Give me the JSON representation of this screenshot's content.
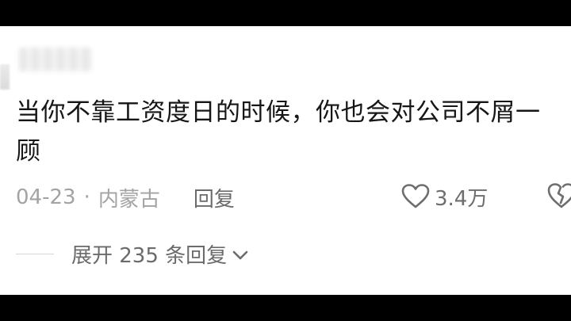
{
  "comment": {
    "text": "当你不靠工资度日的时候，你也会对公司不屑一顾",
    "date": "04-23",
    "separator": "·",
    "location": "内蒙古",
    "reply_label": "回复",
    "like_count": "3.4万"
  },
  "replies": {
    "expand_label": "展开 235 条回复"
  },
  "icons": {
    "like": "heart-outline-icon",
    "dislike": "broken-heart-icon",
    "expand": "chevron-down-icon"
  },
  "colors": {
    "background": "#ffffff",
    "text": "#161616",
    "meta_text": "#a3a3a3",
    "action_text": "#6b6b6b",
    "letterbox": "#000000"
  }
}
